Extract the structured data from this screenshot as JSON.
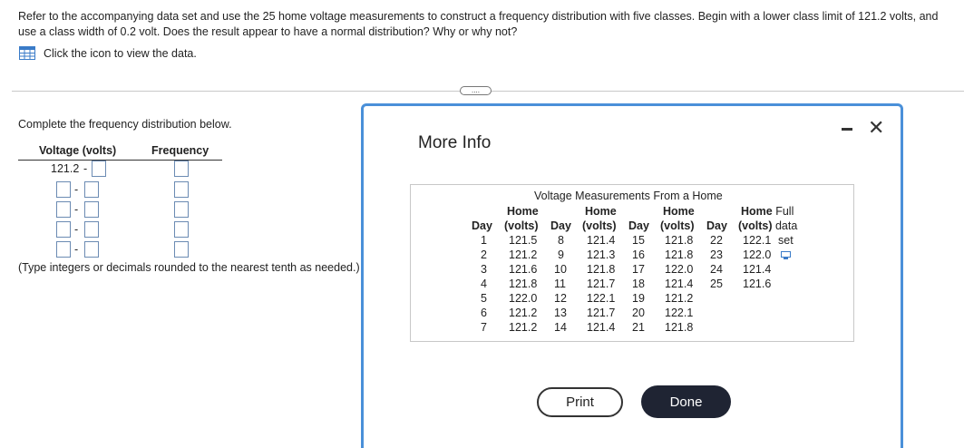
{
  "question": {
    "text": "Refer to the accompanying data set and use the 25 home voltage measurements to construct a frequency distribution with five classes. Begin with a lower class limit of 121.2 volts, and use a class width of 0.2 volt. Does the result appear to have a normal distribution? Why or why not?",
    "data_link_label": "Click the icon to view the data."
  },
  "more_button": "....",
  "frequency_table": {
    "instruction": "Complete the frequency distribution below.",
    "col_voltage": "Voltage (volts)",
    "col_frequency": "Frequency",
    "first_lower": "121.2",
    "dash": "-",
    "hint": "(Type integers or decimals rounded to the nearest tenth as needed.)"
  },
  "dialog": {
    "title": "More Info",
    "minimize": "−",
    "close": "✕",
    "table_caption": "Voltage Measurements From a Home",
    "header_top": [
      "Home",
      "Home",
      "Home",
      "Home Full"
    ],
    "header_bottom": [
      "Day",
      "(volts)",
      "Day",
      "(volts)",
      "Day",
      "(volts)",
      "Day",
      "(volts) data"
    ],
    "columns": [
      {
        "days": [
          "1",
          "2",
          "3",
          "4",
          "5",
          "6",
          "7"
        ],
        "volts": [
          "121.5",
          "121.2",
          "121.6",
          "121.8",
          "122.0",
          "121.2",
          "121.2"
        ]
      },
      {
        "days": [
          "8",
          "9",
          "10",
          "11",
          "12",
          "13",
          "14"
        ],
        "volts": [
          "121.4",
          "121.3",
          "121.8",
          "121.7",
          "122.1",
          "121.7",
          "121.4"
        ]
      },
      {
        "days": [
          "15",
          "16",
          "17",
          "18",
          "19",
          "20",
          "21"
        ],
        "volts": [
          "121.8",
          "121.8",
          "122.0",
          "121.4",
          "121.2",
          "122.1",
          "121.8"
        ]
      },
      {
        "days": [
          "22",
          "23",
          "24",
          "25"
        ],
        "volts": [
          "122.1",
          "122.0",
          "121.4",
          "121.6"
        ]
      }
    ],
    "set_label": "set",
    "print_label": "Print",
    "done_label": "Done"
  }
}
